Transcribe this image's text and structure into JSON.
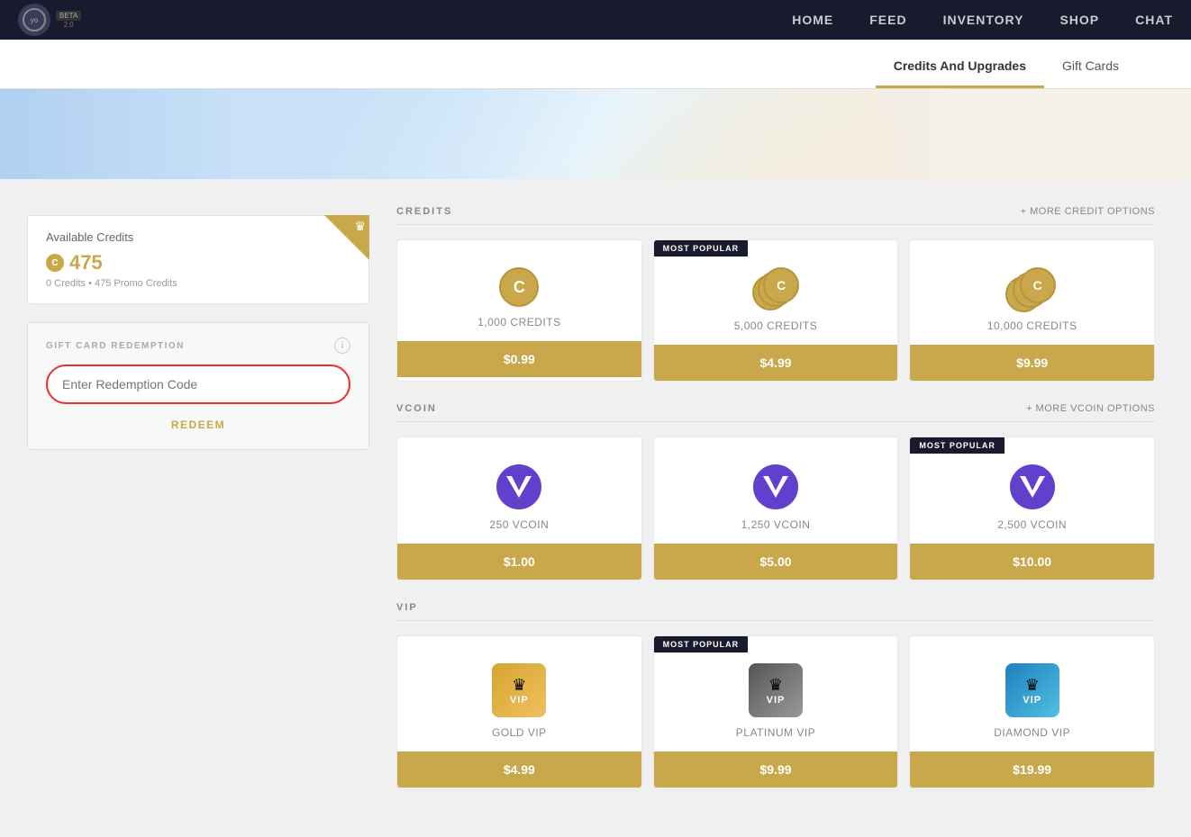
{
  "navbar": {
    "logo_text": "2.0",
    "beta_label": "BETA",
    "links": [
      {
        "label": "HOME",
        "key": "home"
      },
      {
        "label": "FEED",
        "key": "feed"
      },
      {
        "label": "INVENTORY",
        "key": "inventory"
      },
      {
        "label": "SHOP",
        "key": "shop"
      },
      {
        "label": "CHAT",
        "key": "chat"
      }
    ]
  },
  "subnav": {
    "items": [
      {
        "label": "Credits And Upgrades",
        "active": true
      },
      {
        "label": "Gift Cards",
        "active": false
      }
    ]
  },
  "credits": {
    "title": "Available Credits",
    "amount": "475",
    "coin_symbol": "C",
    "breakdown": "0 Credits • 475 Promo Credits"
  },
  "gift_card": {
    "section_title": "GIFT CARD REDEMPTION",
    "input_placeholder": "Enter Redemption Code",
    "redeem_label": "REDEEM"
  },
  "credits_section": {
    "title": "CREDITS",
    "more_options": "+ MORE CREDIT OPTIONS",
    "cards": [
      {
        "label": "1,000 CREDITS",
        "price": "$0.99",
        "most_popular": false,
        "coin_size": "single"
      },
      {
        "label": "5,000 CREDITS",
        "price": "$4.99",
        "most_popular": true,
        "coin_size": "double"
      },
      {
        "label": "10,000 CREDITS",
        "price": "$9.99",
        "most_popular": false,
        "coin_size": "triple"
      }
    ],
    "most_popular_label": "MOST POPULAR"
  },
  "vcoin_section": {
    "title": "VCOIN",
    "more_options": "+ MORE VCOIN OPTIONS",
    "cards": [
      {
        "label": "250 VCOIN",
        "price": "$1.00",
        "most_popular": false
      },
      {
        "label": "1,250 VCOIN",
        "price": "$5.00",
        "most_popular": false
      },
      {
        "label": "2,500 VCOIN",
        "price": "$10.00",
        "most_popular": true
      }
    ],
    "most_popular_label": "MOST POPULAR"
  },
  "vip_section": {
    "title": "VIP",
    "cards": [
      {
        "label": "GOLD VIP",
        "price": "$4.99",
        "most_popular": false,
        "type": "gold"
      },
      {
        "label": "PLATINUM VIP",
        "price": "$9.99",
        "most_popular": true,
        "type": "platinum"
      },
      {
        "label": "DIAMOND VIP",
        "price": "$19.99",
        "most_popular": false,
        "type": "diamond"
      }
    ],
    "most_popular_label": "MOST POPULAR"
  },
  "colors": {
    "gold": "#c8a84b",
    "dark_nav": "#1a1a2e",
    "purple": "#6040cc",
    "red_border": "#e83030"
  }
}
